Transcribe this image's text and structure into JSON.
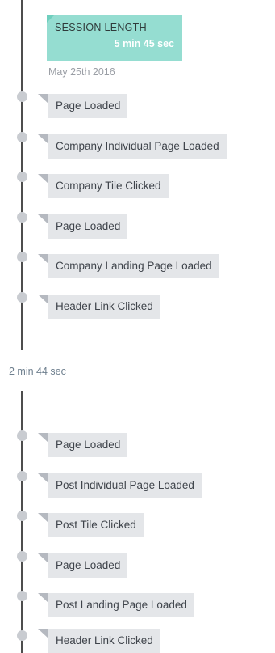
{
  "session": {
    "title": "SESSION LENGTH",
    "duration": "5 min 45 sec",
    "date": "May 25th 2016"
  },
  "gap": {
    "label": "2 min 44 sec"
  },
  "events": [
    {
      "label": "Page Loaded"
    },
    {
      "label": "Company Individual Page Loaded"
    },
    {
      "label": "Company Tile Clicked"
    },
    {
      "label": "Page Loaded"
    },
    {
      "label": "Company Landing Page Loaded"
    },
    {
      "label": "Header Link Clicked"
    },
    {
      "label": "Page Loaded"
    },
    {
      "label": "Post Individual Page Loaded"
    },
    {
      "label": "Post Tile Clicked"
    },
    {
      "label": "Page Loaded"
    },
    {
      "label": "Post Landing Page Loaded"
    },
    {
      "label": "Header Link Clicked"
    }
  ],
  "colors": {
    "session_card": "#95ddd1",
    "track": "#4d4d4d",
    "event_pill": "#e4e6e9",
    "dot": "#c9ccd1"
  }
}
